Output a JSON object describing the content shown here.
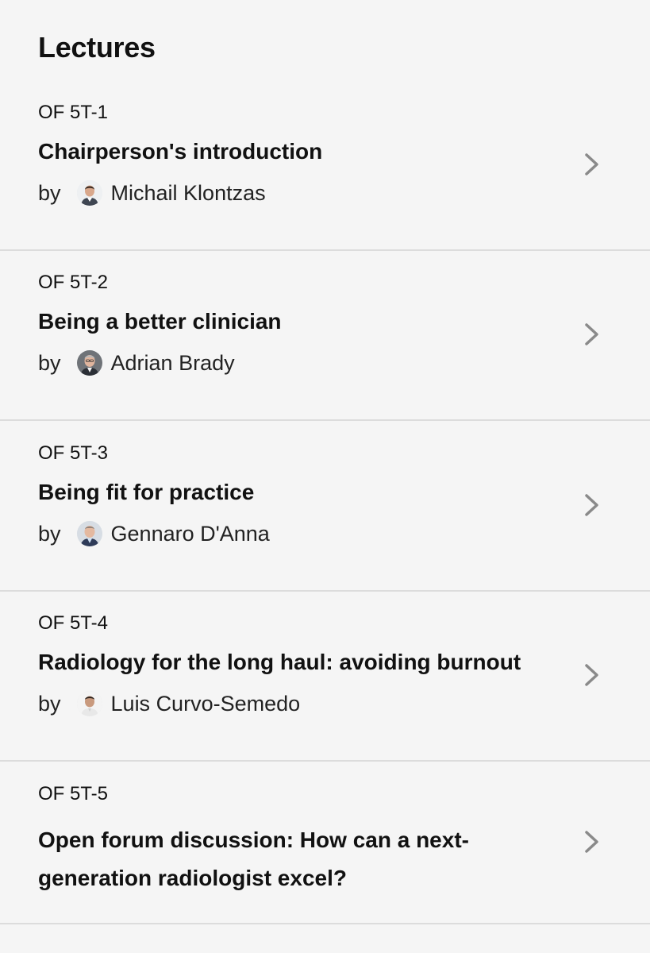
{
  "header": {
    "title": "Lectures"
  },
  "lectures": [
    {
      "code": "OF 5T-1",
      "title": "Chairperson's introduction",
      "by": "by",
      "speaker": "Michail Klontzas"
    },
    {
      "code": "OF 5T-2",
      "title": "Being a better clinician",
      "by": "by",
      "speaker": "Adrian Brady"
    },
    {
      "code": "OF 5T-3",
      "title": "Being fit for practice",
      "by": "by",
      "speaker": "Gennaro D'Anna"
    },
    {
      "code": "OF 5T-4",
      "title": "Radiology for the long haul: avoiding burnout",
      "by": "by",
      "speaker": "Luis Curvo-Semedo"
    },
    {
      "code": "OF 5T-5",
      "title": "Open forum discussion: How can a next-generation radiologist excel?"
    }
  ],
  "icons": {
    "chevron": "chevron-right-icon",
    "avatar": "speaker-avatar"
  },
  "colors": {
    "background": "#f5f5f5",
    "divider": "#dcdcdc",
    "chevron": "#8a8a8a",
    "text": "#111111"
  }
}
